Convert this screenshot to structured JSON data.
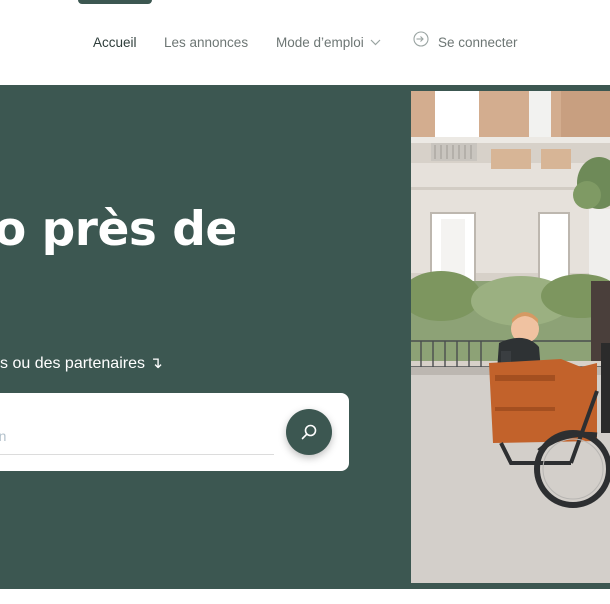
{
  "header": {
    "nav": {
      "home_label": "Accueil",
      "ads_label": "Les annonces",
      "guide_label": "Mode d’emploi",
      "login_label": "Se connecter"
    }
  },
  "hero": {
    "title": "o près de",
    "subtitle": "s ou des partenaires ↴",
    "search": {
      "placeholder": "calisation"
    }
  },
  "colors": {
    "hero_background": "#3c5751",
    "nav_text": "#6d7674",
    "search_button": "#3c5751"
  },
  "icons": {
    "guide_dropdown": "chevron-down-icon",
    "login": "login-icon",
    "search": "search-icon"
  }
}
